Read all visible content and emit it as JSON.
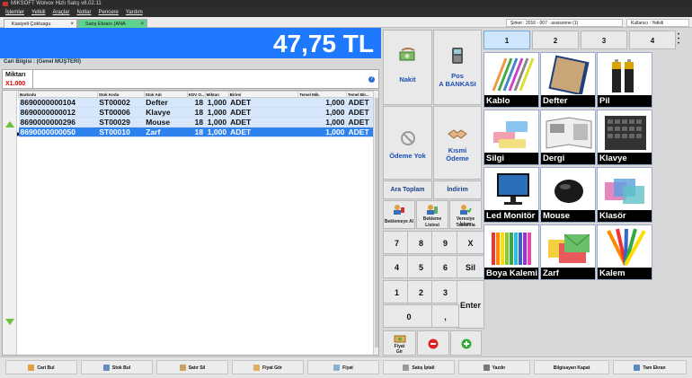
{
  "window": {
    "title": "MIKSOFT Wolvox Hizlı Satış v8.02.11"
  },
  "menu": [
    "İşlemler",
    "Yetkili",
    "Araçlar",
    "Notlar",
    "Pencere",
    "Yardım"
  ],
  "tabs": [
    {
      "label": "Kasiyeli Çoklusgu"
    },
    {
      "label": "Satış Ekranı (ANA KASA/MÜ)"
    }
  ],
  "header": {
    "company": "Şirket : 2016 - 007 - assisonne (1)",
    "user": "Kullanıcı : Yetkili"
  },
  "total": {
    "amount": "47,75 TL"
  },
  "cari": {
    "label": "Cari Bilgisi : (Genel MÜŞTERİ)"
  },
  "quantity": {
    "label": "Miktarı",
    "value": "X1.000"
  },
  "grid": {
    "columns": [
      "Barkodu",
      "Stok Kodu",
      "Stok Adı",
      "KDV O...",
      "Miktarı",
      "Birimi",
      "Temel Mik.",
      "Temel Bir..."
    ],
    "rows": [
      [
        "8690000000104",
        "ST00002",
        "Defter",
        "18",
        "1,000",
        "ADET",
        "1,000",
        "ADET"
      ],
      [
        "8690000000012",
        "ST00006",
        "Klavye",
        "18",
        "1,000",
        "ADET",
        "1,000",
        "ADET"
      ],
      [
        "8690000000296",
        "ST00029",
        "Mouse",
        "18",
        "1,000",
        "ADET",
        "1,000",
        "ADET"
      ],
      [
        "8690000000050",
        "ST00010",
        "Zarf",
        "18",
        "1,000",
        "ADET",
        "1,000",
        "ADET"
      ]
    ]
  },
  "payments": {
    "cash": "Nakit",
    "pos_line1": "Pos",
    "pos_line2": "A BANKASI",
    "no_payment": "Ödeme Yok",
    "partial_line1": "Kısmi",
    "partial_line2": "Ödeme",
    "subtotal": "Ara Toplam",
    "discount": "İndirim"
  },
  "actions": {
    "hold": "Beklemeye Al",
    "hold_list_1": "Bekleme",
    "hold_list_2": "Listesi",
    "complete_1": "Veresiye İşlem",
    "complete_2": "Tamamla",
    "price_entry_1": "Fiyat",
    "price_entry_2": "Gir"
  },
  "keypad": {
    "k7": "7",
    "k8": "8",
    "k9": "9",
    "kx": "X",
    "k4": "4",
    "k5": "5",
    "k6": "6",
    "ksil": "Sil",
    "k1": "1",
    "k2": "2",
    "k3": "3",
    "kenter": "Enter",
    "k0": "0",
    "kcomma": ","
  },
  "categories": [
    "1",
    "2",
    "3",
    "4"
  ],
  "products": [
    "Kablo",
    "Defter",
    "Pil",
    "Silgi",
    "Dergi",
    "Klavye",
    "Led Monitör",
    "Mouse",
    "Klasör",
    "Boya Kalemi",
    "Zarf",
    "Kalem"
  ],
  "bottom": [
    "Cari Bul",
    "Stok Bul",
    "Satır Sil",
    "Fiyat Gör",
    "Fiyat",
    "Satış İptali",
    "Yazdır",
    "Bilgisayarı Kapat",
    "Tam Ekran"
  ],
  "colors": {
    "price_bar": "#1f79ff",
    "selected_row": "#2d82f0",
    "tab_active": "#5fd38d",
    "payment_text": "#1a4fb5"
  }
}
